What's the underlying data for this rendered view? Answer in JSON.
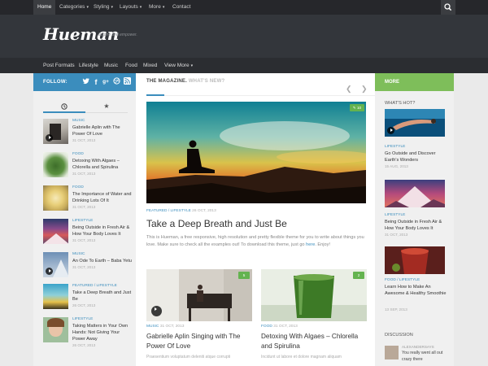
{
  "colors": {
    "accent": "#3b8dbd",
    "more": "#7ebe5a",
    "topbar": "#26272b",
    "header": "#33363b"
  },
  "topnav": {
    "items": [
      "Home",
      "Categories",
      "Styling",
      "Layouts",
      "More",
      "Contact"
    ],
    "search_icon": "search-icon"
  },
  "header": {
    "logo": "Hueman",
    "tagline": "Inspire and empower."
  },
  "subnav": {
    "items": [
      "Post Formats",
      "Lifestyle",
      "Music",
      "Food",
      "Mixed",
      "View More"
    ]
  },
  "follow": {
    "label": "FOLLOW:",
    "icons": [
      "twitter-icon",
      "facebook-icon",
      "google-plus-icon",
      "dribbble-icon",
      "rss-icon"
    ]
  },
  "sidebar_tabs": [
    "clock-icon",
    "star-icon"
  ],
  "sidebar_posts": [
    {
      "category": "MUSIC",
      "title": "Gabrielle Aplin with The Power Of Love",
      "date": "31 OCT, 2013"
    },
    {
      "category": "FOOD",
      "title": "Detoxing With Algaes – Chlorella and Spirulina",
      "date": "31 OCT, 2013"
    },
    {
      "category": "FOOD",
      "title": "The Importance of Water and Drinking Lots Of It",
      "date": "31 OCT, 2013"
    },
    {
      "category": "LIFESTYLE",
      "title": "Being Outside in Fresh Air & How Your Body Loves It",
      "date": "31 OCT, 2013"
    },
    {
      "category": "MUSIC",
      "title": "An Ode To Earth – Baba Yetu",
      "date": "31 OCT, 2013"
    },
    {
      "category": "FEATURED / LIFESTYLE",
      "title": "Take a Deep Breath and Just Be",
      "date": "26 OCT, 2013"
    },
    {
      "category": "LIFESTYLE",
      "title": "Taking Matters in Your Own Hands: Not Giving Your Power Away",
      "date": "26 OCT, 2013"
    }
  ],
  "featured": {
    "heading": "THE MAGAZINE.",
    "subheading": "WHAT'S NEW?",
    "comments": "10",
    "category": "FEATURED / LIFESTYLE",
    "date": "26 OCT, 2013",
    "title": "Take a Deep Breath and Just Be",
    "excerpt": "This is Hueman, a free responsive, high resolution and pretty flexible theme for you to write about things you love. Make sure to check all the examples out! To download this theme, just go",
    "link": "here",
    "excerpt_end": ". Enjoy!"
  },
  "cards": [
    {
      "category": "MUSIC",
      "date": "31 OCT, 2013",
      "comments": "5",
      "title": "Gabrielle Aplin Singing with The Power Of Love",
      "excerpt": "Praesentium voluptatum deleniti atque corrupti"
    },
    {
      "category": "FOOD",
      "date": "31 OCT, 2013",
      "comments": "2",
      "title": "Detoxing With Algaes – Chlorella and Spirulina",
      "excerpt": "Incidunt ut labore et dolore magnam aliquam"
    }
  ],
  "right": {
    "more_label": "MORE",
    "hot_title": "WHAT'S HOT?",
    "posts": [
      {
        "category": "LIFESTYLE",
        "title": "Go Outside and Discover Earth's Wonders",
        "date": "15 AUG, 2013"
      },
      {
        "category": "LIFESTYLE",
        "title": "Being Outside in Fresh Air & How Your Body Loves It",
        "date": "31 OCT, 2013"
      },
      {
        "category": "FOOD / LIFESTYLE",
        "title": "Learn How to Make An Awesome & Healthy Smoothie",
        "date": "13 SEP, 2013"
      }
    ],
    "discussion_title": "DISCUSSION",
    "discussion_name": "ALEXANDERSAYS",
    "discussion_text": "You really went all out crazy there"
  }
}
